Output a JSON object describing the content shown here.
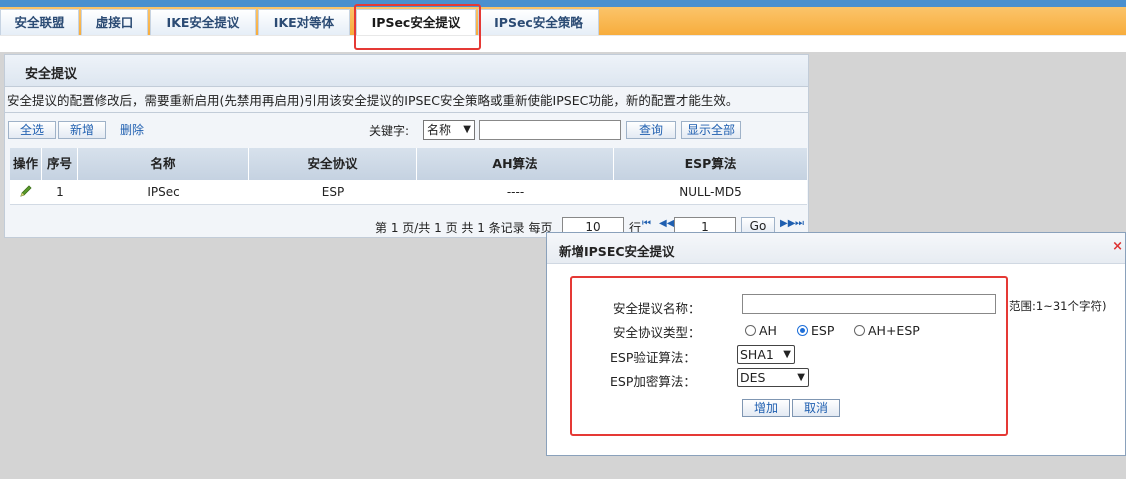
{
  "tabs": [
    {
      "label": "安全联盟"
    },
    {
      "label": "虚接口"
    },
    {
      "label": "IKE安全提议"
    },
    {
      "label": "IKE对等体"
    },
    {
      "label": "IPSec安全提议"
    },
    {
      "label": "IPSec安全策略"
    }
  ],
  "active_tab": "IPSec安全提议",
  "panel": {
    "title": "安全提议",
    "notice": "安全提议的配置修改后，需要重新启用(先禁用再启用)引用该安全提议的IPSEC安全策略或重新使能IPSEC功能，新的配置才能生效。"
  },
  "toolbar": {
    "select_all": "全选",
    "add": "新增",
    "delete": "删除",
    "keyword_label": "关键字:",
    "keyword_field": "名称",
    "query": "查询",
    "show_all": "显示全部"
  },
  "table": {
    "columns": [
      "操作",
      "序号",
      "名称",
      "安全协议",
      "AH算法",
      "ESP算法"
    ],
    "rows": [
      {
        "index": "1",
        "name": "IPSec",
        "protocol": "ESP",
        "ah": "----",
        "esp": "NULL-MD5"
      }
    ]
  },
  "pager": {
    "text_before": "第 1 页/共 1 页 共 1 条记录 每页",
    "per_page": "10",
    "text_after": "行",
    "page": "1",
    "go": "Go"
  },
  "dialog": {
    "title": "新增IPSEC安全提议",
    "close": "×",
    "name_label": "安全提议名称：",
    "name_value": "",
    "name_hint": "范围:1~31个字符)",
    "protocol_label": "安全协议类型：",
    "protocol_options": [
      "AH",
      "ESP",
      "AH+ESP"
    ],
    "protocol_selected": "ESP",
    "esp_auth_label": "ESP验证算法：",
    "esp_auth_value": "SHA1",
    "esp_enc_label": "ESP加密算法：",
    "esp_enc_value": "DES",
    "add_button": "增加",
    "cancel_button": "取消"
  },
  "colors": {
    "tabbar": "#f7ad3d",
    "highlight": "#e53935",
    "link": "#1f5fb0"
  }
}
